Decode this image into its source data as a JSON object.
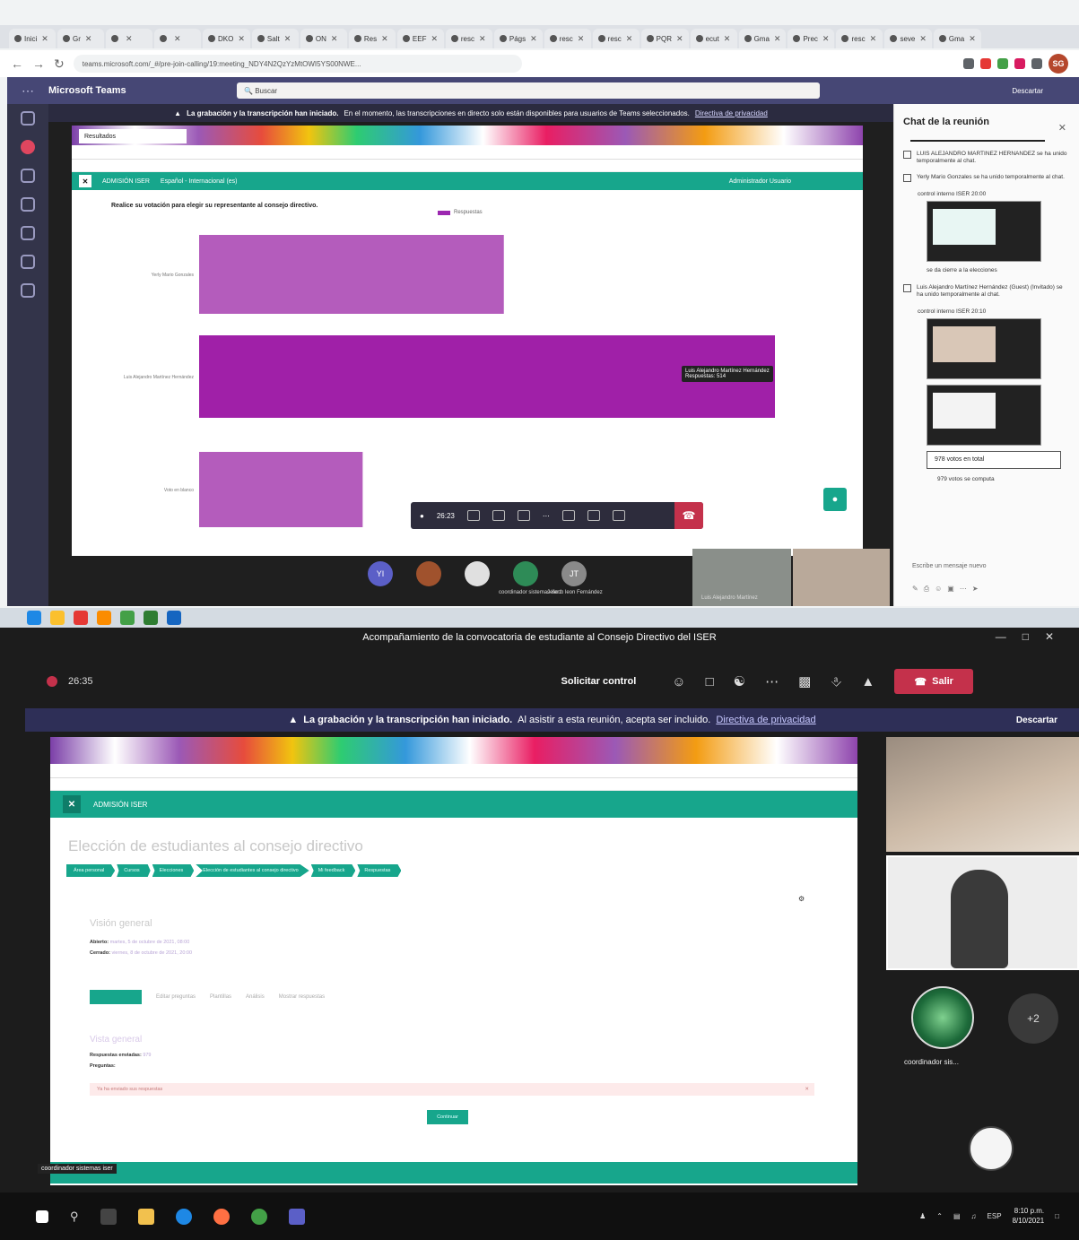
{
  "browser": {
    "tabs": [
      "Inici",
      "Gr",
      "",
      "",
      "DKO",
      "Salt",
      "ON",
      "Res",
      "EEF",
      "resc",
      "Págs",
      "resc",
      "resc",
      "PQR",
      "ecut",
      "Gma",
      "Prec",
      "resc",
      "seve",
      "Gma"
    ],
    "url": "teams.microsoft.com/_#/pre-join-calling/19:meeting_NDY4N2QzYzMtOWI5YS00NWE...",
    "profile_initials": "SG"
  },
  "teams_web": {
    "brand": "Microsoft Teams",
    "search_placeholder": "Buscar",
    "dismiss": "Descartar",
    "banner_bold": "La grabación y la transcripción han iniciado.",
    "banner_text": "En el momento, las transcripciones en directo solo están disponibles para usuarios de Teams seleccionados.",
    "banner_link": "Directiva de privacidad"
  },
  "shared_screen_top": {
    "tab_title": "Resultados",
    "moodle_brand": "ADMISIÓN ISER",
    "moodle_lang": "Español - Internacional (es)",
    "admin_label": "Administrador Usuario",
    "question": "Realice su votación para elegir su representante al consejo directivo.",
    "legend": "Respuestas",
    "tooltip_name": "Luis Alejandro Martínez Hernández",
    "tooltip_value": "Respuestas: 514"
  },
  "chart_data": {
    "type": "bar",
    "orientation": "horizontal",
    "title": "Realice su votación para elegir su representante al consejo directivo.",
    "categories": [
      "Yerly Mario Gonzales",
      "Luis Alejandro Martínez Hernández",
      "Voto en blanco"
    ],
    "series": [
      {
        "name": "Respuestas",
        "values": [
          272,
          514,
          146
        ]
      }
    ],
    "xlim": [
      0,
      514
    ],
    "grid": false,
    "legend": "top-center",
    "color": "#a24bb0"
  },
  "call_controls_top": {
    "timer": "26:23"
  },
  "participants_top": {
    "avatars": [
      {
        "initials": "YI",
        "color": "#5b5fc7"
      },
      {
        "initials": "",
        "color": "#a0522d"
      },
      {
        "initials": "",
        "color": "#e0e0e0"
      },
      {
        "initials": "",
        "color": "#2e8b57",
        "caption": "coordinador sistemas ise..."
      },
      {
        "initials": "JT",
        "color": "#8a8a8a",
        "caption": "Jeferth leon Fernández"
      }
    ],
    "tile_caption": "Luis Alejandro Martínez"
  },
  "chat": {
    "title": "Chat de la reunión",
    "events": [
      "LUIS ALEJANDRO MARTINEZ HERNANDEZ se ha unido temporalmente al chat.",
      "Yerly Mario Gonzales se ha unido temporalmente al chat."
    ],
    "sender1": "control interno ISER 20:00",
    "msg1": "se da cierre a la elecciones",
    "event3": "Luis Alejandro Martínez Hernández (Guest) (Invitado) se ha unido temporalmente al chat.",
    "sender2": "control interno ISER 20:10",
    "votes_total": "978 votos en total",
    "votes_sub": "979 votos se computa",
    "compose_placeholder": "Escribe un mensaje nuevo"
  },
  "teams_desktop": {
    "meeting_title": "Acompañamiento de la convocatoria de estudiante al Consejo Directivo del ISER",
    "timer": "26:35",
    "request_control": "Solicitar control",
    "leave": "Salir",
    "banner_bold": "La grabación y la transcripción han iniciado.",
    "banner_text": "Al asistir a esta reunión, acepta ser incluido.",
    "banner_link": "Directiva de privacidad",
    "dismiss": "Descartar",
    "more_participants": "+2",
    "coordinator_name": "coordinador sis...",
    "presenter_label": "coordinador sistemas iser"
  },
  "shared_screen_bottom": {
    "moodle_brand": "ADMISIÓN ISER",
    "heading": "Elección de estudiantes al consejo directivo",
    "breadcrumbs": [
      "Área personal",
      "Cursos",
      "Elecciones",
      "Elección de estudiantes al consejo directivo",
      "Mi feedback",
      "Respuestas"
    ],
    "section_title": "Visión general",
    "opened_label": "Abierto:",
    "opened_value": "martes, 5 de octubre de 2021, 08:00",
    "closed_label": "Cerrado:",
    "closed_value": "viernes, 8 de octubre de 2021, 20:00",
    "tabs": [
      "Vista general",
      "Editar preguntas",
      "Plantillas",
      "Análisis",
      "Mostrar respuestas"
    ],
    "section_title2": "Vista general",
    "responses_label": "Respuestas enviadas:",
    "responses_value": "979",
    "questions_label": "Preguntas:",
    "alert_text": "Ya ha enviado sus respuestas",
    "continue_button": "Continuar"
  },
  "windows": {
    "lang": "ESP",
    "time": "8:10 p.m.",
    "date": "8/10/2021"
  }
}
